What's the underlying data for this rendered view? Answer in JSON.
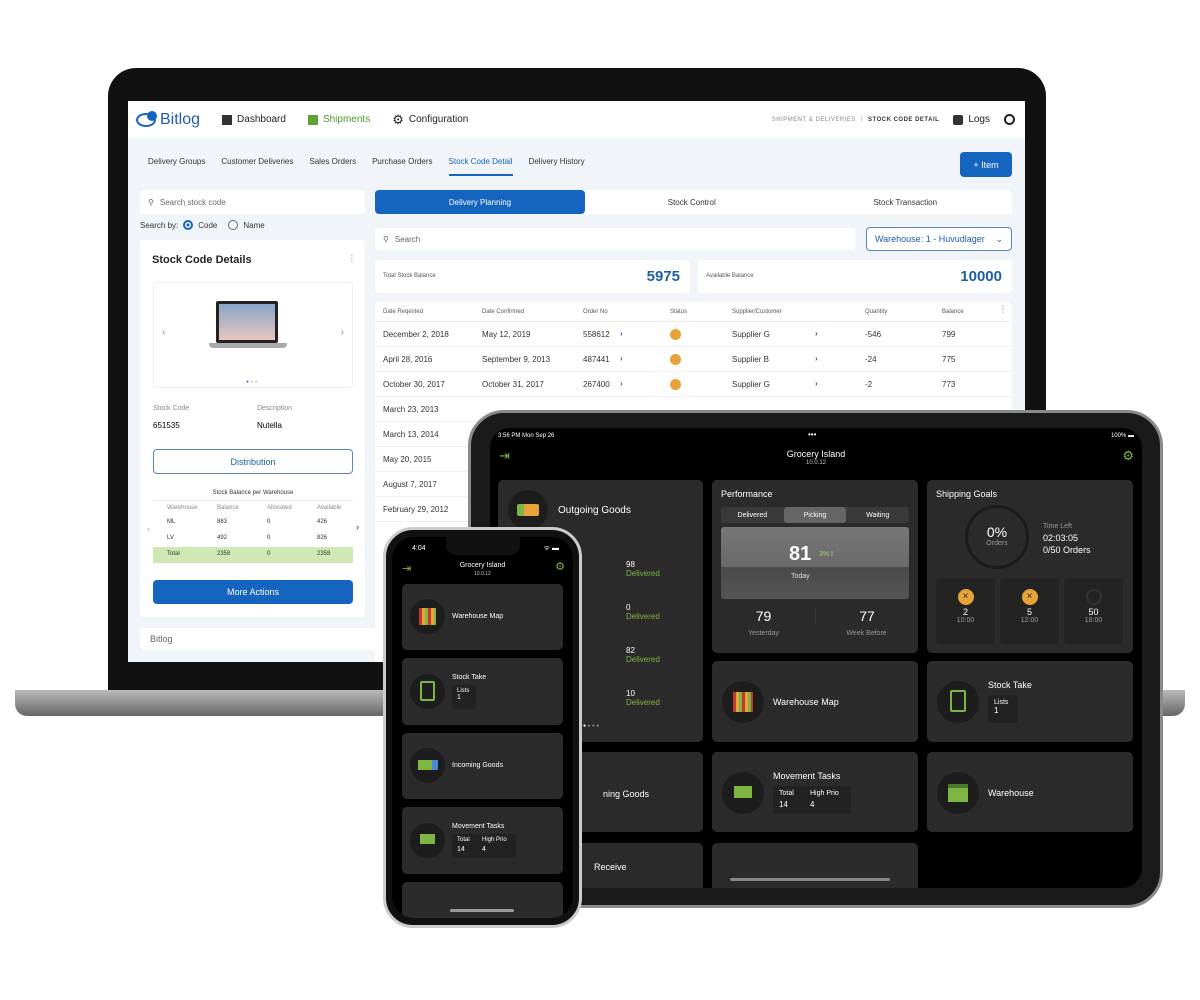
{
  "colors": {
    "primary": "#1565c0",
    "green": "#7fb545",
    "status_pending": "#e7a33a"
  },
  "laptop": {
    "logo": "Bitlog",
    "nav": [
      {
        "label": "Dashboard",
        "icon": "grid-icon"
      },
      {
        "label": "Shipments",
        "icon": "truck-icon"
      },
      {
        "label": "Configuration",
        "icon": "gear-icon"
      }
    ],
    "breadcrumb": {
      "parent": "SHIPMENT & DELIVERIES",
      "sep": "/",
      "current": "STOCK CODE DETAIL"
    },
    "logs": "Logs",
    "tabs": [
      "Delivery Groups",
      "Customer Deliveries",
      "Sales Orders",
      "Purchase Orders",
      "Stock Code Detail",
      "Delivery History"
    ],
    "add_item": "+ Item",
    "left": {
      "search_placeholder": "Search stock code",
      "search_by": "Search by:",
      "opt_code": "Code",
      "opt_name": "Name",
      "title": "Stock Code Details",
      "stock_code_label": "Stock Code",
      "stock_code": "651535",
      "desc_label": "Description",
      "desc": "Nutella",
      "distribution": "Distribution",
      "balance_title": "Stock Balance per Warehouse",
      "balance_headers": [
        "Warehouse",
        "Balance",
        "Allocated",
        "Available"
      ],
      "balance_rows": [
        [
          "ML",
          "883",
          "0",
          "426"
        ],
        [
          "LV",
          "492",
          "0",
          "826"
        ],
        [
          "Total",
          "2358",
          "0",
          "2358"
        ]
      ],
      "more_actions": "More Actions",
      "footer_logo": "Bitlog"
    },
    "subtabs": [
      "Delivery Planning",
      "Stock Control",
      "Stock Transaction"
    ],
    "search_placeholder": "Search",
    "warehouse_select": "Warehouse: 1 - Huvudlager",
    "total_label": "Total Stock Balance",
    "total_value": "5975",
    "avail_label": "Available Balance",
    "avail_value": "10000",
    "table_headers": [
      "Date Reqested",
      "Date Confirmed",
      "Order No",
      "Status",
      "Supplier/Customer",
      "Quantity",
      "Balance"
    ],
    "rows": [
      [
        "December 2, 2018",
        "May 12, 2019",
        "558612",
        "Supplier G",
        "-546",
        "799"
      ],
      [
        "April 28, 2016",
        "September 9, 2013",
        "487441",
        "Supplier B",
        "-24",
        "775"
      ],
      [
        "October 30, 2017",
        "October 31, 2017",
        "267400",
        "Supplier G",
        "-2",
        "773"
      ]
    ],
    "more_dates": [
      "March 23, 2013",
      "March 13, 2014",
      "May 20, 2015",
      "August 7, 2017",
      "February 29, 2012"
    ]
  },
  "tablet": {
    "time": "3:56 PM  Mon Sep 26",
    "battery": "100%",
    "title": "Grocery Island",
    "version": "10.0.12",
    "outgoing": {
      "title": "Outgoing Goods",
      "items": [
        {
          "v": "98",
          "l": "Delivered"
        },
        {
          "v": "0",
          "l": "Delivered"
        },
        {
          "v": "82",
          "l": "Delivered"
        },
        {
          "v": "10",
          "l": "Delivered"
        }
      ]
    },
    "performance": {
      "title": "Performance",
      "tabs": [
        "Delivered",
        "Picking",
        "Waiting"
      ],
      "today": "81",
      "today_label": "Today",
      "delta": "3%",
      "yesterday": "79",
      "yesterday_label": "Yesterday",
      "week": "77",
      "week_label": "Week Before"
    },
    "goals": {
      "title": "Shipping Goals",
      "pct": "0%",
      "pct_label": "Orders",
      "time_left_label": "Time Left",
      "time_left": "02:03:05",
      "orders": "0/50 Orders",
      "slots": [
        {
          "v": "2",
          "t": "10:00"
        },
        {
          "v": "5",
          "t": "12:00"
        },
        {
          "v": "50",
          "t": "18:00"
        }
      ]
    },
    "warehouse_map": "Warehouse Map",
    "stock_take": {
      "title": "Stock Take",
      "lists_label": "Lists",
      "lists": "1"
    },
    "incoming": "ning Goods",
    "movement": {
      "title": "Movement Tasks",
      "total_label": "Total",
      "total": "14",
      "prio_label": "High Prio",
      "prio": "4"
    },
    "warehouse": "Warehouse",
    "receive": "Receive"
  },
  "phone": {
    "time": "4:04",
    "title": "Grocery Island",
    "version": "10.0.12",
    "warehouse_map": "Warehouse Map",
    "stock_take": {
      "title": "Stock Take",
      "lists_label": "Lists",
      "lists": "1"
    },
    "incoming": "Incoming Goods",
    "movement": {
      "title": "Movement Tasks",
      "total_label": "Total",
      "total": "14",
      "prio_label": "High Prio",
      "prio": "4"
    }
  }
}
